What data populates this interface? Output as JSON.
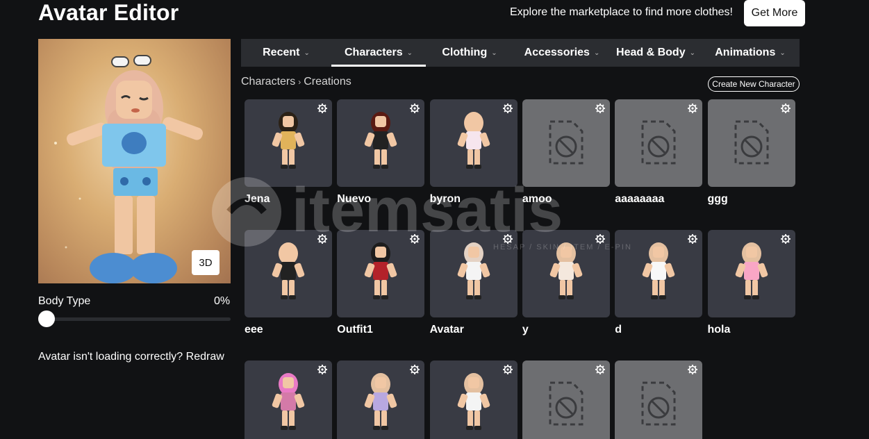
{
  "header": {
    "title": "Avatar Editor",
    "market_text": "Explore the marketplace to find more clothes!",
    "get_more_label": "Get More"
  },
  "preview": {
    "view_toggle_label": "3D"
  },
  "body_type": {
    "label": "Body Type",
    "value_label": "0%",
    "value": 0
  },
  "redraw_text": "Avatar isn't loading correctly?  Redraw",
  "tabs": [
    {
      "label": "Recent",
      "active": false
    },
    {
      "label": "Characters",
      "active": true
    },
    {
      "label": "Clothing",
      "active": false
    },
    {
      "label": "Accessories",
      "active": false
    },
    {
      "label": "Head & Body",
      "active": false
    },
    {
      "label": "Animations",
      "active": false
    }
  ],
  "breadcrumb": {
    "parent": "Characters",
    "current": "Creations"
  },
  "create_button_label": "Create New Character",
  "characters": [
    {
      "name": "Jena",
      "image": "available"
    },
    {
      "name": "Nuevo",
      "image": "available"
    },
    {
      "name": "byron",
      "image": "available"
    },
    {
      "name": "amoo",
      "image": "unavailable"
    },
    {
      "name": "aaaaaaaa",
      "image": "unavailable"
    },
    {
      "name": "ggg",
      "image": "unavailable"
    },
    {
      "name": "eee",
      "image": "available"
    },
    {
      "name": "Outfit1",
      "image": "available"
    },
    {
      "name": "Avatar",
      "image": "available"
    },
    {
      "name": "y",
      "image": "available"
    },
    {
      "name": "d",
      "image": "available"
    },
    {
      "name": "hola",
      "image": "available"
    },
    {
      "name": "",
      "image": "available"
    },
    {
      "name": "",
      "image": "available"
    },
    {
      "name": "",
      "image": "available"
    },
    {
      "name": "",
      "image": "unavailable"
    },
    {
      "name": "",
      "image": "unavailable"
    }
  ],
  "watermark": {
    "text": "itemsatis",
    "subtext": "HESAP / SKIN / ITEM / E-PIN"
  },
  "colors": {
    "background": "#111214",
    "tab_bar": "#2b2d31",
    "card": "#393b44",
    "card_empty": "#6d6e71",
    "accent": "#ffffff"
  },
  "icons": {
    "tab_chevron": "chevron-down-icon",
    "card_settings": "gear-icon",
    "no_image": "image-unavailable-icon"
  }
}
